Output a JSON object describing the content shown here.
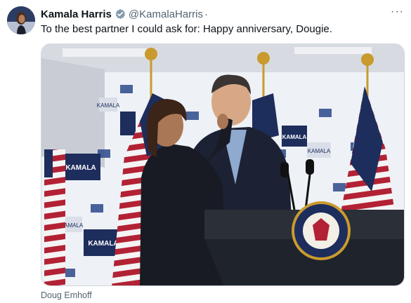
{
  "tweet": {
    "author_name": "Kamala Harris",
    "handle": "@KamalaHarris",
    "separator": "·",
    "more_label": "···",
    "text": "To the best partner I could ask for: Happy anniversary, Dougie.",
    "media_caption": "Doug Emhoff"
  },
  "photo": {
    "backdrop_labels": [
      "KAMALA",
      "KAMALA",
      "KAMALA",
      "KAMALA",
      "KAMALA",
      "KAMALA"
    ],
    "colors": {
      "navy": "#1d2d5c",
      "flag_red": "#b22234",
      "backdrop": "#eef1f6",
      "podium": "#2a2f38",
      "gold": "#c99a2e"
    }
  },
  "icons": {
    "verified": "verified-badge-icon",
    "more": "more-options-icon"
  }
}
